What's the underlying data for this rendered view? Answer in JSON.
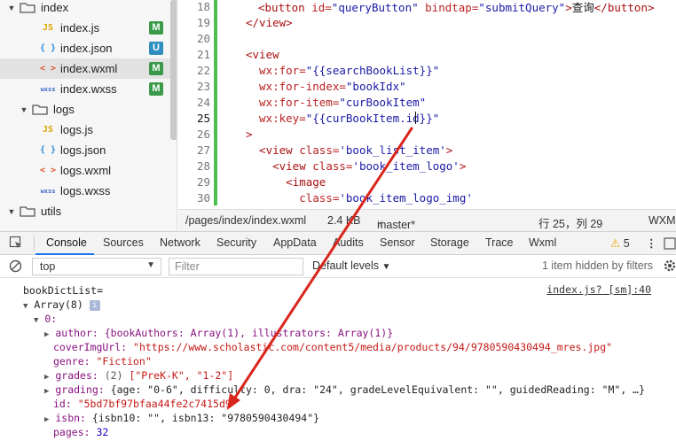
{
  "tree": {
    "items": [
      {
        "label": "index",
        "kind": "folder"
      },
      {
        "label": "index.js",
        "icon": "JS",
        "badge": "M"
      },
      {
        "label": "index.json",
        "icon": "{ }",
        "badge": "U"
      },
      {
        "label": "index.wxml",
        "icon": "< >",
        "badge": "M"
      },
      {
        "label": "index.wxss",
        "icon": "wxss",
        "badge": "M"
      },
      {
        "label": "logs",
        "kind": "folder"
      },
      {
        "label": "logs.js",
        "icon": "JS"
      },
      {
        "label": "logs.json",
        "icon": "{ }"
      },
      {
        "label": "logs.wxml",
        "icon": "< >"
      },
      {
        "label": "logs.wxss",
        "icon": "wxss"
      },
      {
        "label": "utils",
        "kind": "folder"
      }
    ]
  },
  "editor": {
    "lines": [
      {
        "num": "18",
        "parts": [
          [
            "t-tag",
            "<button "
          ],
          [
            "t-attr",
            "id="
          ],
          [
            "t-str",
            "\"queryButton\" "
          ],
          [
            "t-attr",
            "bindtap="
          ],
          [
            "t-str",
            "\"submitQuery\""
          ],
          [
            "t-tag",
            ">"
          ],
          [
            "t-txt",
            "查询"
          ],
          [
            "t-tag",
            "</button>"
          ]
        ]
      },
      {
        "num": "19",
        "parts": [
          [
            "t-tag",
            "</view>"
          ]
        ]
      },
      {
        "num": "20",
        "parts": []
      },
      {
        "num": "21",
        "parts": [
          [
            "t-tag",
            "<view"
          ]
        ]
      },
      {
        "num": "22",
        "parts": [
          [
            "t-attr",
            "  wx:for="
          ],
          [
            "t-str",
            "\"{{searchBookList}}\""
          ]
        ]
      },
      {
        "num": "23",
        "parts": [
          [
            "t-attr",
            "  wx:for-index="
          ],
          [
            "t-str",
            "\"bookIdx\""
          ]
        ]
      },
      {
        "num": "24",
        "parts": [
          [
            "t-attr",
            "  wx:for-item="
          ],
          [
            "t-str",
            "\"curBookItem\""
          ]
        ]
      },
      {
        "num": "25",
        "parts": [
          [
            "t-attr",
            "  wx:key="
          ],
          [
            "t-str",
            "\"{{curBookItem.id}}\""
          ]
        ]
      },
      {
        "num": "26",
        "parts": [
          [
            "t-tag",
            ">"
          ]
        ]
      },
      {
        "num": "27",
        "parts": [
          [
            "t-tag",
            "  <view "
          ],
          [
            "t-attr",
            "class="
          ],
          [
            "t-str",
            "'book_list_item'"
          ],
          [
            "t-tag",
            ">"
          ]
        ]
      },
      {
        "num": "28",
        "parts": [
          [
            "t-tag",
            "    <view "
          ],
          [
            "t-attr",
            "class="
          ],
          [
            "t-str",
            "'book_item_logo'"
          ],
          [
            "t-tag",
            ">"
          ]
        ]
      },
      {
        "num": "29",
        "parts": [
          [
            "t-tag",
            "      <image"
          ]
        ]
      },
      {
        "num": "30",
        "parts": [
          [
            "t-attr",
            "        class="
          ],
          [
            "t-str",
            "'book_item_logo_img'"
          ]
        ]
      }
    ]
  },
  "status": {
    "path": "/pages/index/index.wxml",
    "size": "2.4 KB",
    "branch": "master*",
    "position": "行 25，列 29",
    "mode": "WXML"
  },
  "devtools": {
    "tabs": [
      "Console",
      "Sources",
      "Network",
      "Security",
      "AppData",
      "Audits",
      "Sensor",
      "Storage",
      "Trace",
      "Wxml"
    ],
    "warning_count": "5"
  },
  "toolbar": {
    "context": "top",
    "filter_placeholder": "Filter",
    "levels": "Default levels",
    "hidden_note": "1 item hidden by filters"
  },
  "console": {
    "label": "bookDictList=",
    "source": "index.js? [sm]:40",
    "array_label": "Array(8)",
    "index0": "0:",
    "author_line": "author: {bookAuthors: Array(1), illustrators: Array(1)}",
    "cover_key": "coverImgUrl: ",
    "cover_val": "\"https://www.scholastic.com/content5/media/products/94/9780590430494_mres.jpg\"",
    "genre_key": "genre: ",
    "genre_val": "\"Fiction\"",
    "grades_key": "grades: ",
    "grades_count": "(2) ",
    "grades_val": "[\"PreK-K\", \"1-2\"]",
    "grading_key": "grading: ",
    "grading_val": "{age: \"0-6\", difficulty: 0, dra: \"24\", gradeLevelEquivalent: \"\", guidedReading: \"M\", …}",
    "id_key": "id: ",
    "id_val": "\"5bd7bf97bfaa44fe2c7415d9\"",
    "isbn_key": "isbn: ",
    "isbn_val": "{isbn10: \"\", isbn13: \"9780590430494\"}",
    "pages_key": "pages: ",
    "pages_val": "32"
  },
  "colors": {
    "arrow": "#d9261c",
    "accent": "#1a73e8",
    "git_modified": "#3a9a4a"
  }
}
